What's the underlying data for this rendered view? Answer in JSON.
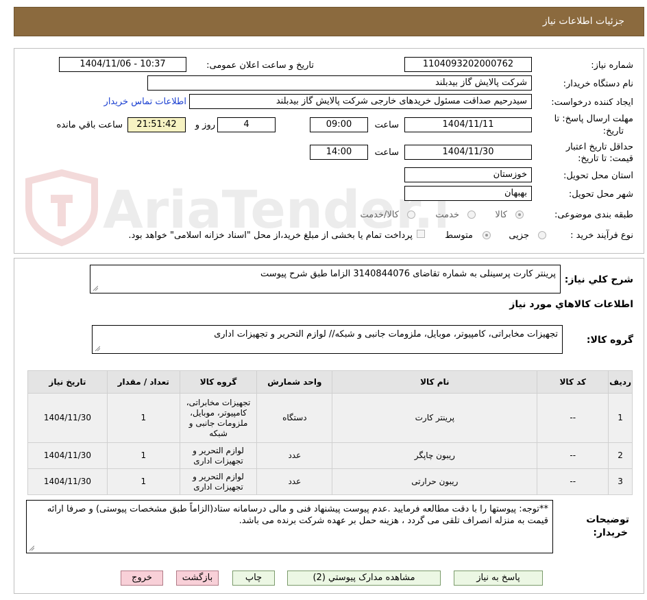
{
  "header": {
    "title": "جزئیات اطلاعات نیاز"
  },
  "watermark": {
    "text": "AriaTender.neT"
  },
  "form": {
    "need_number_label": "شماره نیاز:",
    "need_number": "1104093202000762",
    "announce_label": "تاریخ و ساعت اعلان عمومی:",
    "announce_value": "1404/11/06 - 10:37",
    "buyer_org_label": "نام دستگاه خریدار:",
    "buyer_org": "شرکت پالایش گاز بیدبلند",
    "requester_label": "ایجاد کننده درخواست:",
    "requester": "سیدرحیم صداقت مسئول خریدهای خارجی شرکت پالایش گاز بیدبلند",
    "contact_link": "اطلاعات تماس خریدار",
    "deadline_label_1": "مهلت ارسال پاسخ: تا",
    "deadline_label_2": "تاریخ:",
    "deadline_date": "1404/11/11",
    "time_label": "ساعت",
    "deadline_time": "09:00",
    "days_value": "4",
    "days_label": "روز و",
    "remaining_time": "21:51:42",
    "remaining_label": "ساعت باقي مانده",
    "validity_label_1": "حداقل تاریخ اعتبار",
    "validity_label_2": "قیمت: تا تاریخ:",
    "validity_date": "1404/11/30",
    "validity_time": "14:00",
    "province_label": "استان محل تحویل:",
    "province": "خوزستان",
    "city_label": "شهر محل تحویل:",
    "city": "بهبهان",
    "category_label": "طبقه بندی موضوعی:",
    "category_options": [
      "کالا",
      "خدمت",
      "کالا/خدمت"
    ],
    "process_label": "نوع فرآیند خرید :",
    "process_options": [
      "جزیی",
      "متوسط"
    ],
    "payment_note": "پرداخت تمام یا بخشی از مبلغ خرید،از محل \"اسناد خزانه اسلامی\" خواهد بود."
  },
  "summary": {
    "label": "شرح کلي نیاز:",
    "text": "پرینتر کارت پرسینلی به شماره تقاضای 3140844076  الزاما طبق شرح پیوست"
  },
  "goods": {
    "section_title": "اطلاعات کالاهاي مورد نیاز",
    "group_label": "گروه کالا:",
    "group_text": "تجهیزات مخابراتی، کامپیوتر، موبایل، ملزومات جانبی و شبکه// لوازم التحریر و تجهیزات اداری"
  },
  "table": {
    "headers": [
      "ردیف",
      "کد کالا",
      "نام کالا",
      "واحد شمارش",
      "گروه کالا",
      "تعداد / مقدار",
      "تاریخ نیاز"
    ],
    "rows": [
      {
        "row": "1",
        "code": "--",
        "name": "پرینتر کارت",
        "unit": "دستگاه",
        "group": "تجهیزات مخابراتی، کامپیوتر، موبایل، ملزومات جانبی و شبکه",
        "qty": "1",
        "date": "1404/11/30"
      },
      {
        "row": "2",
        "code": "--",
        "name": "ریبون چاپگر",
        "unit": "عدد",
        "group": "لوازم التحریر و تجهیزات اداری",
        "qty": "1",
        "date": "1404/11/30"
      },
      {
        "row": "3",
        "code": "--",
        "name": "ریبون حرارتی",
        "unit": "عدد",
        "group": "لوازم التحریر و تجهیزات اداری",
        "qty": "1",
        "date": "1404/11/30"
      }
    ]
  },
  "notes": {
    "label_1": "توضیحات",
    "label_2": "خریدار:",
    "text": "**توجه: پیوستها را با دقت مطالعه فرمایید .عدم پیوست پیشنهاد فنی و مالی درسامانه ستاد(الزاماً طبق مشخصات پیوستی) و صرفا ارائه قیمت به منزله انصراف تلقی می گردد ، هزینه حمل بر عهده شرکت برنده می باشد."
  },
  "buttons": {
    "reply": "پاسخ به نیاز",
    "attachments": "مشاهده مدارک پیوستي (2)",
    "print": "چاپ",
    "back": "بازگشت",
    "exit": "خروج"
  },
  "colors": {
    "header_bg": "#8b6a3e",
    "link": "#1a3fd1",
    "remaining_bg": "#f6f2c2"
  }
}
